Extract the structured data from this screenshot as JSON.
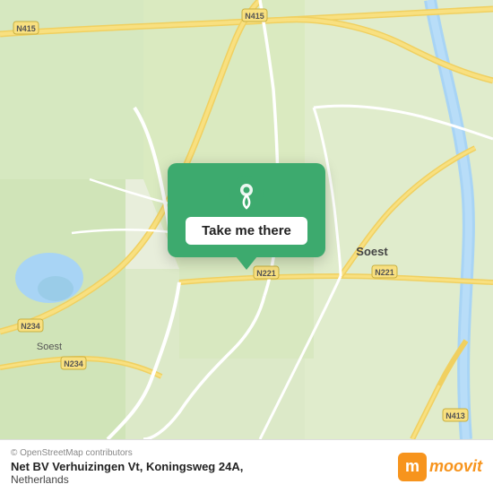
{
  "map": {
    "attribution": "© OpenStreetMap contributors",
    "location": {
      "name": "Net BV Verhuizingen Vt, Koningsweg 24A",
      "country": "Netherlands"
    }
  },
  "popup": {
    "button_label": "Take me there"
  },
  "footer": {
    "attribution": "© OpenStreetMap contributors",
    "address_line1": "Net BV Verhuizingen Vt, Koningsweg 24A,",
    "address_line2": "Netherlands"
  },
  "moovit": {
    "letter": "m",
    "text": "moovit"
  },
  "roads": {
    "n415_label": "N415",
    "n234_label": "N234",
    "n221_label": "N221",
    "n413_label": "N413"
  },
  "towns": {
    "soest": "Soest"
  }
}
